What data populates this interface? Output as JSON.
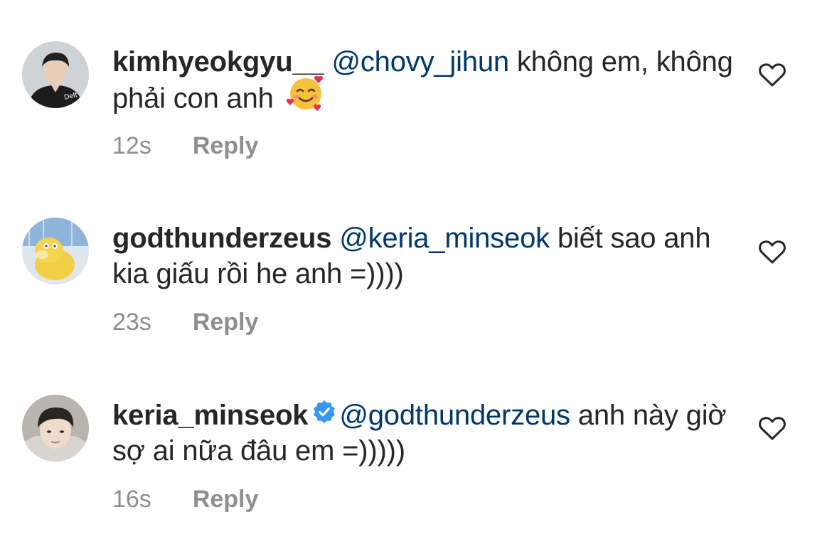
{
  "comments": [
    {
      "username": "kimhyeokgyu__",
      "mention": "@chovy_jihun",
      "text": " không em, không phải con anh",
      "time": "12s",
      "reply_label": "Reply",
      "emoji": "smiling-face-with-hearts"
    },
    {
      "username": "godthunderzeus",
      "mention": "@keria_minseok",
      "text": " biết sao anh kia giấu rồi he anh =))))",
      "time": "23s",
      "reply_label": "Reply"
    },
    {
      "username": "keria_minseok",
      "verified": true,
      "mention": "@godthunderzeus",
      "text": " anh này giờ sợ ai nữa đâu em =)))))",
      "time": "16s",
      "reply_label": "Reply"
    }
  ],
  "colors": {
    "mention": "#00376b",
    "meta": "#8e8e8e",
    "verified": "#3897f0",
    "text": "#262626"
  },
  "icons": {
    "like": "heart-outline-icon",
    "verified": "verified-badge-icon"
  }
}
